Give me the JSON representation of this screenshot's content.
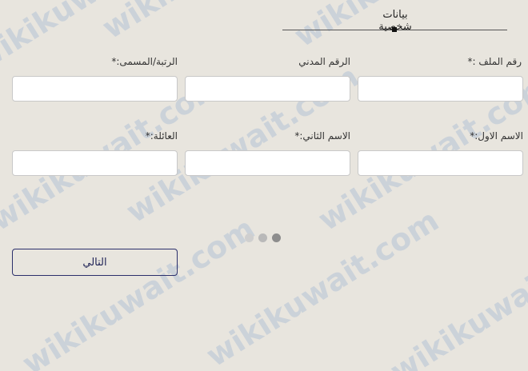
{
  "watermark": "wikikuwait.com",
  "tab": {
    "title": "بيانات شخصية"
  },
  "fields": {
    "file_number": {
      "label": "رقم الملف :*",
      "value": "",
      "placeholder": ""
    },
    "civil_id": {
      "label": "الرقم المدني",
      "value": "",
      "placeholder": ""
    },
    "rank_title": {
      "label": "الرتبة/المسمى:*",
      "value": "",
      "placeholder": ""
    },
    "first_name": {
      "label": "الاسم الاول:*",
      "value": "",
      "placeholder": ""
    },
    "second_name": {
      "label": "الاسم الثاني:*",
      "value": "",
      "placeholder": ""
    },
    "family_name": {
      "label": "العائلة:*",
      "value": "",
      "placeholder": ""
    }
  },
  "pager": {
    "dots": 3,
    "active_index": 2
  },
  "buttons": {
    "next_label": "التالي"
  },
  "colors": {
    "background": "#e8e5de",
    "button_border": "#2b2f6b",
    "watermark": "#c2ccd8"
  }
}
